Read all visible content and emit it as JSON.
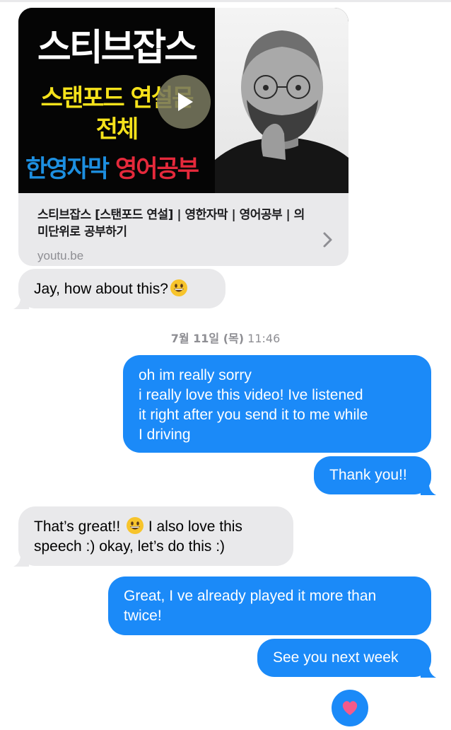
{
  "link_preview": {
    "thumbnail": {
      "line1": "스티브잡스",
      "line2": "스탠포드 연설문",
      "line3": "전체",
      "line4_part1": "한영자막",
      "line4_part2": "영어공부"
    },
    "title": "스티브잡스 [스탠포드 연설] | 영한자막 | 영어공부 | 의미단위로 공부하기",
    "domain": "youtu.be",
    "play_icon": "play-icon",
    "chevron_icon": "chevron-right-icon"
  },
  "timestamp": {
    "date": "7월 11일 (목)",
    "time": "11:46"
  },
  "messages": [
    {
      "direction": "received",
      "text": "Jay, how about this?",
      "emoji": "grinning-face"
    },
    {
      "direction": "sent",
      "lines": [
        "oh im really sorry",
        "i really love this video! Ive listened",
        "it right after you send it to me while",
        "I driving"
      ]
    },
    {
      "direction": "sent",
      "text": "Thank you!!"
    },
    {
      "direction": "received",
      "text_before_emoji": "That’s great!! ",
      "text_after_emoji": " I also love this",
      "line2": "speech :) okay, let’s do this :)",
      "emoji": "grinning-face"
    },
    {
      "direction": "sent",
      "lines": [
        "Great, I ve already played it more than",
        "twice!"
      ]
    },
    {
      "direction": "sent",
      "text": "See you next week"
    }
  ],
  "tapback": {
    "icon": "heart-icon"
  },
  "colors": {
    "sent_bubble": "#1b8af8",
    "received_bubble": "#e9e9eb",
    "timestamp_text": "#8e8e93"
  }
}
